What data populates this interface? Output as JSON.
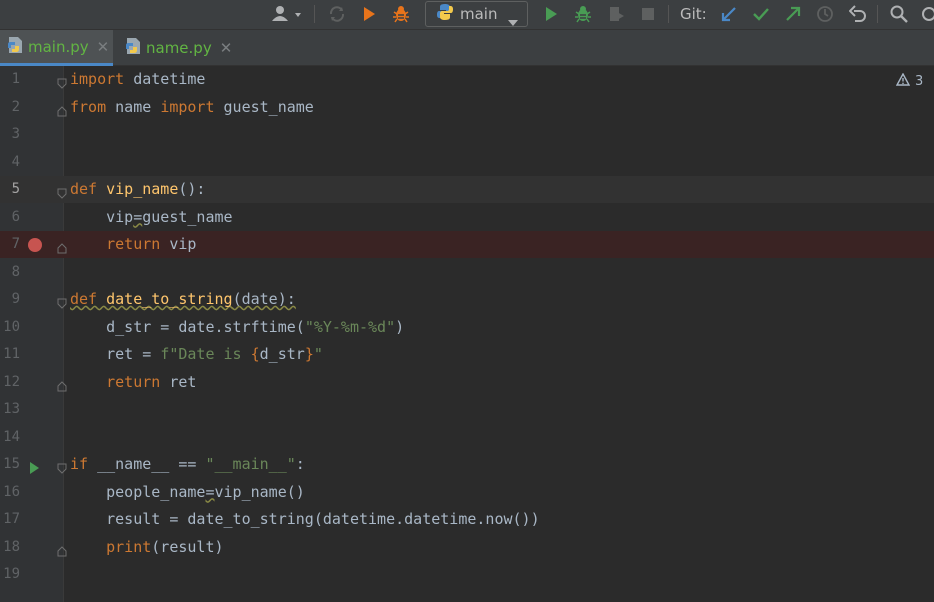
{
  "toolbar": {
    "run_config": "main",
    "git_label": "Git:"
  },
  "tabs": [
    {
      "name": "main.py",
      "active": true,
      "color": "#62b543"
    },
    {
      "name": "name.py",
      "active": false,
      "color": "#62b543"
    }
  ],
  "editor": {
    "warning_count": "3",
    "line_numbers": [
      "1",
      "2",
      "3",
      "4",
      "5",
      "6",
      "7",
      "8",
      "9",
      "10",
      "11",
      "12",
      "13",
      "14",
      "15",
      "16",
      "17",
      "18",
      "19"
    ],
    "current_line": 5,
    "breakpoint_line": 7,
    "run_gutter_line": 15
  },
  "colors": {
    "keyword": "#cc7832",
    "function": "#ffc66d",
    "string": "#6a8759",
    "identifier": "#a9b7c6",
    "breakpoint": "#c75450",
    "run_green": "#499c54",
    "git_blue": "#4a88c7"
  },
  "icons": [
    "user-icon",
    "sync-icon",
    "run-icon",
    "debug-icon",
    "python-icon",
    "run-green-icon",
    "debug-green-icon",
    "coverage-icon",
    "stop-icon",
    "git-update-icon",
    "git-commit-icon",
    "git-push-icon",
    "history-icon",
    "rollback-icon",
    "search-icon",
    "warning-icon"
  ]
}
